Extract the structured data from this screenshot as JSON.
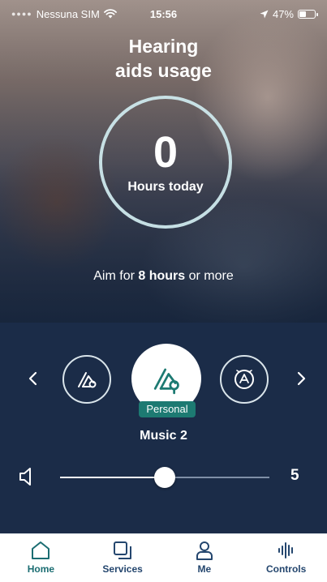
{
  "status_bar": {
    "carrier": "Nessuna SIM",
    "time": "15:56",
    "battery": "47%",
    "battery_level": 0.47,
    "icons": [
      "wifi-icon",
      "location-arrow-icon",
      "battery-icon"
    ]
  },
  "usage": {
    "title_line1": "Hearing",
    "title_line2": "aids usage",
    "hours": "0",
    "hours_label": "Hours today",
    "aim_prefix": "Aim for ",
    "aim_value": "8 hours",
    "aim_suffix": " or more"
  },
  "programs": {
    "badge": "Personal",
    "current_name": "Music 2",
    "items": [
      {
        "icon": "program-left-icon",
        "selected": false
      },
      {
        "icon": "program-personal-icon",
        "selected": true
      },
      {
        "icon": "program-auto-icon",
        "selected": false
      }
    ]
  },
  "volume": {
    "value": "5",
    "level": 0.5
  },
  "tabs": [
    {
      "label": "Home",
      "icon": "home-icon",
      "active": true
    },
    {
      "label": "Services",
      "icon": "services-icon",
      "active": false
    },
    {
      "label": "Me",
      "icon": "person-icon",
      "active": false
    },
    {
      "label": "Controls",
      "icon": "controls-waveform-icon",
      "active": false
    }
  ],
  "colors": {
    "panel_bg": "#1b2c48",
    "accent_teal": "#1d7a72",
    "tab_active": "#1b6d72",
    "tab_inactive": "#24466e"
  }
}
